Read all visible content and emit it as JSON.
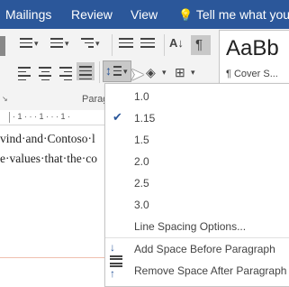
{
  "ribbon_tabs": [
    "Mailings",
    "Review",
    "View"
  ],
  "tell_me": "Tell me what you w",
  "group_label": "Paragraph",
  "group_label_visible": "Parag",
  "styles": {
    "preview": "AaBb",
    "name": "¶ Cover S..."
  },
  "ruler_text": "· 1 · · · 1 · · · 1 ·",
  "document": {
    "line1": "vind·and·Contoso·l",
    "line2": "e·values·that·the·co"
  },
  "menu": {
    "options": [
      "1.0",
      "1.15",
      "1.5",
      "2.0",
      "2.5",
      "3.0"
    ],
    "selected": "1.15",
    "line_spacing_options": "Line Spacing Options...",
    "add_space_before": "Add Space Before Paragraph",
    "remove_space_after": "Remove Space After Paragraph",
    "add_before_underline_letter": "B",
    "remove_after_underline_letter": "A"
  },
  "colors": {
    "ribbon_tab_bg": "#2b579a",
    "ribbon_bg": "#f3f3f3",
    "check": "#2b579a"
  }
}
